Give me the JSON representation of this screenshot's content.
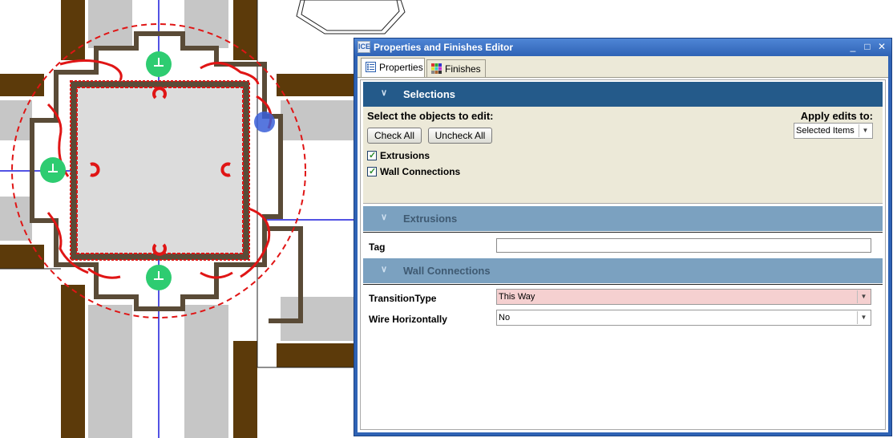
{
  "window": {
    "title": "Properties and Finishes Editor",
    "app_icon_text": "ICE",
    "minimize": "_",
    "maximize": "□",
    "close": "✕"
  },
  "tabs": [
    {
      "label": "Properties",
      "active": true
    },
    {
      "label": "Finishes",
      "active": false
    }
  ],
  "selections": {
    "header": "Selections",
    "prompt": "Select the objects to edit:",
    "check_all": "Check All",
    "uncheck_all": "Uncheck All",
    "apply_label": "Apply edits to:",
    "apply_value": "Selected Items",
    "items": [
      {
        "label": "Extrusions",
        "checked": true
      },
      {
        "label": "Wall Connections",
        "checked": true
      }
    ]
  },
  "extrusions": {
    "header": "Extrusions",
    "tag_label": "Tag",
    "tag_value": ""
  },
  "wall_connections": {
    "header": "Wall Connections",
    "transition_label": "TransitionType",
    "transition_value": "This Way",
    "wire_label": "Wire Horizontally",
    "wire_value": "No"
  },
  "colors": {
    "titlebar": "#2f63b5",
    "selections_header": "#245a8a",
    "section_header": "#7ba1c0",
    "highlight_field": "#f5d0d0",
    "wall": "#5c3a0a",
    "frame": "#5a4b37",
    "wire": "#e01515",
    "node": "#2ecc71"
  }
}
